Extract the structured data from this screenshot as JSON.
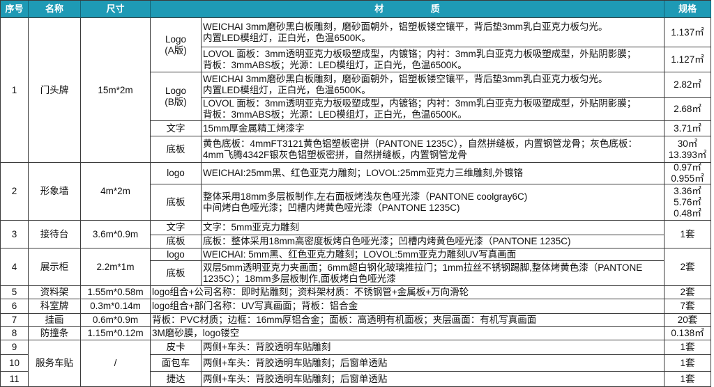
{
  "header": {
    "index": "序号",
    "name": "名称",
    "size": "尺寸",
    "material": "材 质",
    "spec": "规格"
  },
  "rows": [
    {
      "index": "1",
      "name": "门头牌",
      "size": "15m*2m",
      "parts": [
        {
          "label": "Logo\n(A版)",
          "items": [
            {
              "material": "WEICHAI 3mm磨砂黑白板雕刻，磨砂面朝外，铝塑板镂空镶平，背后垫3mm乳白亚克力板匀光。\n内置LED模组灯，正白光，色温6500K。",
              "spec": "1.137㎡"
            },
            {
              "material": "LOVOL 面板：3mm透明亚克力板吸塑成型，内镀铬；内衬：3mm乳白亚克力板吸塑成型，外贴阴影膜；\n背板：3mmABS板；光源：LED模组灯，正白光，色温6500K。",
              "spec": "1.127㎡"
            }
          ]
        },
        {
          "label": "Logo\n(B版)",
          "items": [
            {
              "material": "WEICHAI 3mm磨砂黑白板雕刻，磨砂面朝外，铝塑板镂空镶平，背后垫3mm乳白亚克力板匀光。\n内置LED模组灯，正白光，色温6500K。",
              "spec": "2.82㎡"
            },
            {
              "material": "LOVOL 面板：3mm透明亚克力板吸塑成型，内镀铬；内衬：3mm乳白亚克力板吸塑成型，外贴阴影膜；\n背板：3mmABS板；光源：LED模组灯，正白光，色温6500K。",
              "spec": "2.68㎡"
            }
          ]
        },
        {
          "label": "文字",
          "items": [
            {
              "material": "15mm厚金属精工烤漆字",
              "spec": "3.71㎡"
            }
          ]
        },
        {
          "label": "底板",
          "items": [
            {
              "material": "黄色底板：4mmFT3121黄色铝塑板密拼（PANTONE 1235C），自然拼缝板，内置钢管龙骨；灰色底板：\n4mm飞腾4342F银灰色铝塑板密拼，自然拼缝板，内置钢管龙骨",
              "spec": "30㎡\n13.393㎡"
            }
          ]
        }
      ]
    },
    {
      "index": "2",
      "name": "形象墙",
      "size": "4m*2m",
      "parts": [
        {
          "label": "logo",
          "items": [
            {
              "material": "WEICHAI:25mm黑、红色亚克力雕刻；LOVOL:25mm亚克力三维雕刻,外镀铬",
              "spec": "0.97㎡\n0.955㎡"
            }
          ]
        },
        {
          "label": "底板",
          "items": [
            {
              "material": "整体采用18mm多层板制作,左右面板烤浅灰色哑光漆（PANTONE coolgray6C)\n中间烤白色哑光漆；凹槽内烤黄色哑光漆（PANTONE 1235C)",
              "spec": "3.36㎡\n5.76㎡\n0.48㎡"
            }
          ]
        }
      ]
    },
    {
      "index": "3",
      "name": "接待台",
      "size": "3.6m*0.9m",
      "spec": "1套",
      "parts": [
        {
          "label": "文字",
          "material": "文字：5mm亚克力雕刻"
        },
        {
          "label": "底板",
          "material": "底板：整体采用18mm高密度板烤白色哑光漆；凹槽内烤黄色哑光漆（PANTONE 1235C)"
        }
      ]
    },
    {
      "index": "4",
      "name": "展示柜",
      "size": "2.2m*1m",
      "spec": "2套",
      "parts": [
        {
          "label": "logo",
          "material": "WEICHAI: 5mm黑、红色亚克力雕刻；LOVOL:5mm亚克力雕刻UV写真画面"
        },
        {
          "label": "底板",
          "material": "双层5mm透明亚克力夹画面；6mm超白钢化玻璃推拉门；1mm拉丝不锈钢踢脚,整体烤黄色漆（PANTONE\n1235C）；18mm多层板制作,面板烤白色哑光漆"
        }
      ]
    },
    {
      "index": "5",
      "name": "资料架",
      "size": "1.55m*0.58m",
      "material": "logo组合+公司名称：即时贴雕刻；资料架材质：不锈钢管+金属板+万向滑轮",
      "spec": "2套"
    },
    {
      "index": "6",
      "name": "科室牌",
      "size": "0.3m*0.14m",
      "material": "logo组合+部门名称：UV写真画面；背板：铝合金",
      "spec": "7套"
    },
    {
      "index": "7",
      "name": "挂画",
      "size": "0.6m*0.9m",
      "material": "背板：PVC材质；边框：16mm厚铝合金；面板：高透明有机面板；夹层画面：有机写真画面",
      "spec": "20套"
    },
    {
      "index": "8",
      "name": "防撞条",
      "size": "1.15m*0.12m",
      "material": "3M磨砂膜，logo镂空",
      "spec": "0.138㎡"
    },
    {
      "name": "服务车贴",
      "size": "/",
      "vehicles": [
        {
          "index": "9",
          "label": "皮卡",
          "material": "两侧+车头：背胶透明车贴雕刻",
          "spec": "1套"
        },
        {
          "index": "10",
          "label": "面包车",
          "material": "两侧+车头：背胶透明车贴雕刻；后窗单透贴",
          "spec": "1套"
        },
        {
          "index": "11",
          "label": "捷达",
          "material": "两侧+车头：背胶透明车贴雕刻；后窗单透贴",
          "spec": "1套"
        }
      ]
    }
  ],
  "colors": {
    "header_bg": "#1e9ab5",
    "header_text": "#ffffff",
    "grid_line": "#3a3a3a"
  }
}
